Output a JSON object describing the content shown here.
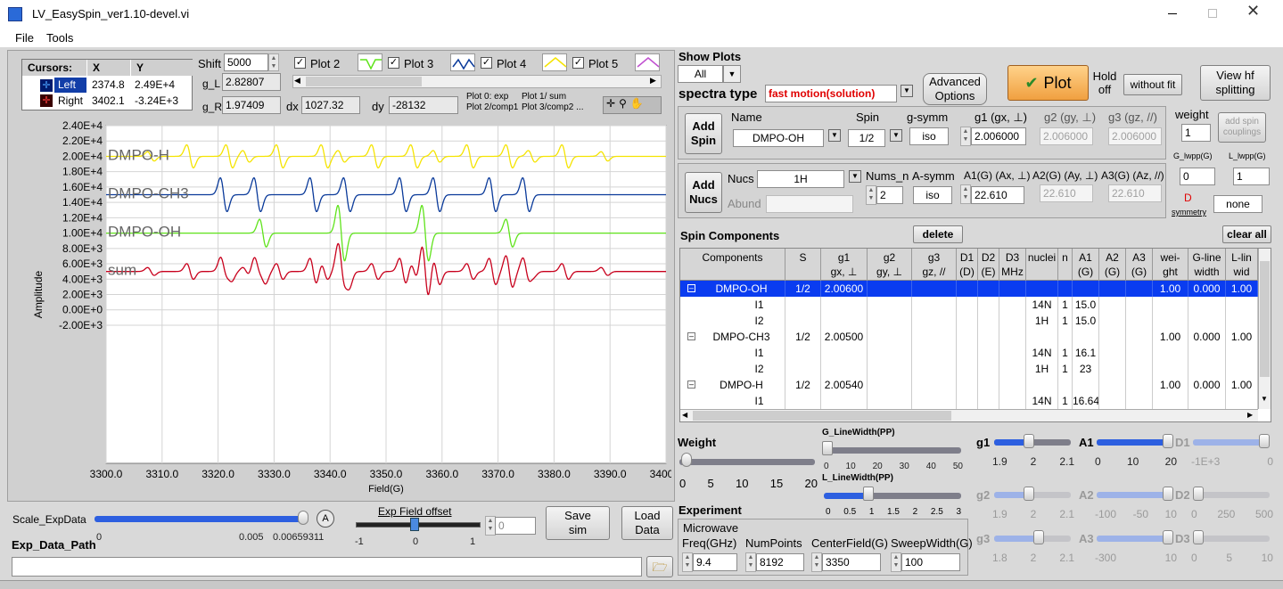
{
  "window": {
    "title": "LV_EasySpin_ver1.10-devel.vi"
  },
  "menu": [
    "File",
    "Tools"
  ],
  "cursors": {
    "header": [
      "Cursors:",
      "X",
      "Y"
    ],
    "rows": [
      {
        "name": "Left",
        "x": "2374.8",
        "y": "2.49E+4"
      },
      {
        "name": "Right",
        "x": "3402.1",
        "y": "-3.24E+3"
      }
    ]
  },
  "shift": {
    "label": "Shift",
    "value": "5000"
  },
  "gL": {
    "label": "g_L",
    "value": "2.82807"
  },
  "gR": {
    "label": "g_R",
    "value": "1.97409"
  },
  "dx": {
    "label": "dx",
    "value": "1027.32"
  },
  "dy": {
    "label": "dy",
    "value": "-28132"
  },
  "plots": [
    "Plot 2",
    "Plot 3",
    "Plot 4",
    "Plot 5"
  ],
  "plot_legend": [
    "Plot 0: exp",
    "Plot 1/ sum",
    "Plot 2/comp1",
    "Plot 3/comp2 ..."
  ],
  "chart_data": {
    "type": "line",
    "xlabel": "Field(G)",
    "ylabel": "Amplitude",
    "xlim": [
      3300,
      3400
    ],
    "ylim": [
      -20000,
      24000
    ],
    "x_ticks": [
      "3300.0",
      "3310.0",
      "3320.0",
      "3330.0",
      "3340.0",
      "3350.0",
      "3360.0",
      "3370.0",
      "3380.0",
      "3390.0",
      "3400.0"
    ],
    "y_ticks": [
      "-2.00E+3",
      "0.00E+0",
      "2.00E+3",
      "4.00E+3",
      "6.00E+3",
      "8.00E+3",
      "1.00E+4",
      "1.20E+4",
      "1.40E+4",
      "1.60E+4",
      "1.80E+4",
      "2.00E+4",
      "2.20E+4",
      "2.40E+4"
    ],
    "series": [
      {
        "name": "DMPO-H",
        "color": "#f5e400",
        "baseline": 20000,
        "amp": 1500,
        "lines": [
          {
            "x": 3308,
            "w": 0.4
          },
          {
            "x": 3315,
            "w": 1
          },
          {
            "x": 3322,
            "w": 1
          },
          {
            "x": 3325,
            "w": 0.5
          },
          {
            "x": 3331,
            "w": 1
          },
          {
            "x": 3339,
            "w": 1
          },
          {
            "x": 3342,
            "w": 0.5
          },
          {
            "x": 3348,
            "w": 1
          },
          {
            "x": 3355,
            "w": 1
          },
          {
            "x": 3359,
            "w": 0.5
          },
          {
            "x": 3365,
            "w": 1
          },
          {
            "x": 3372,
            "w": 1
          },
          {
            "x": 3376,
            "w": 0.5
          },
          {
            "x": 3382,
            "w": 1
          },
          {
            "x": 3389,
            "w": 0.4
          }
        ]
      },
      {
        "name": "DMPO-CH3",
        "color": "#0a3a9a",
        "baseline": 15000,
        "amp": 2200,
        "lines": [
          {
            "x": 3321,
            "w": 1
          },
          {
            "x": 3327,
            "w": 1
          },
          {
            "x": 3337,
            "w": 1
          },
          {
            "x": 3343,
            "w": 1
          },
          {
            "x": 3353,
            "w": 1
          },
          {
            "x": 3359,
            "w": 1
          },
          {
            "x": 3369,
            "w": 1
          },
          {
            "x": 3375,
            "w": 1
          }
        ]
      },
      {
        "name": "DMPO-OH",
        "color": "#5fe31b",
        "baseline": 10000,
        "amp": 3600,
        "lines": [
          {
            "x": 3328,
            "w": 0.5
          },
          {
            "x": 3342,
            "w": 1
          },
          {
            "x": 3357,
            "w": 1
          },
          {
            "x": 3372,
            "w": 0.5
          }
        ]
      },
      {
        "name": "sum",
        "color": "#c8001c",
        "baseline": 5000,
        "amp": 1700,
        "lines": [
          {
            "x": 3308,
            "w": 0.3
          },
          {
            "x": 3315,
            "w": 0.6
          },
          {
            "x": 3321,
            "w": 1
          },
          {
            "x": 3322,
            "w": 0.6
          },
          {
            "x": 3325,
            "w": 0.3
          },
          {
            "x": 3327,
            "w": 1
          },
          {
            "x": 3328,
            "w": 0.8
          },
          {
            "x": 3331,
            "w": 0.6
          },
          {
            "x": 3337,
            "w": 1
          },
          {
            "x": 3339,
            "w": 0.6
          },
          {
            "x": 3342,
            "w": 2
          },
          {
            "x": 3343,
            "w": 1
          },
          {
            "x": 3348,
            "w": 0.6
          },
          {
            "x": 3353,
            "w": 1
          },
          {
            "x": 3355,
            "w": 0.6
          },
          {
            "x": 3357,
            "w": 2
          },
          {
            "x": 3359,
            "w": 1
          },
          {
            "x": 3365,
            "w": 0.6
          },
          {
            "x": 3369,
            "w": 1
          },
          {
            "x": 3372,
            "w": 1.2
          },
          {
            "x": 3375,
            "w": 1
          },
          {
            "x": 3376,
            "w": 0.3
          },
          {
            "x": 3382,
            "w": 0.6
          },
          {
            "x": 3389,
            "w": 0.3
          }
        ]
      }
    ]
  },
  "show_plots": {
    "label": "Show Plots",
    "value": "All"
  },
  "spectra_type": {
    "label": "spectra type",
    "value": "fast motion(solution)"
  },
  "buttons": {
    "advanced": "Advanced Options",
    "plot": "Plot",
    "hold": "Hold off",
    "without_fit": "without fit",
    "view_hf": "View hf splitting",
    "add_spin": "Add Spin",
    "add_nucs": "Add Nucs",
    "delete": "delete",
    "clear_all": "clear all",
    "save_sim": "Save sim",
    "load_data": "Load Data",
    "add_spin_couplings": "add spin couplings"
  },
  "spin": {
    "name_label": "Name",
    "name": "DMPO-OH",
    "spin_label": "Spin",
    "spin": "1/2",
    "gsymm_label": "g-symm",
    "gsymm": "iso",
    "g1_label": "g1 (gx, ⊥)",
    "g1": "2.006000",
    "g2_label": "g2 (gy, ⊥)",
    "g2": "2.006000",
    "g3_label": "g3 (gz, //)",
    "g3": "2.006000",
    "weight_label": "weight",
    "weight": "1"
  },
  "nucs": {
    "nucs_label": "Nucs",
    "nucs": "1H",
    "abund_label": "Abund",
    "numsn_label": "Nums_n",
    "numsn": "2",
    "asymm_label": "A-symm",
    "asymm": "iso",
    "a1_label": "A1(G) (Ax, ⊥)",
    "a1": "22.610",
    "a2_label": "A2(G) (Ay, ⊥)",
    "a2": "22.610",
    "a3_label": "A3(G) (Az, //)",
    "a3": "22.610"
  },
  "lw": {
    "g_label": "G_lwpp(G)",
    "g": "0",
    "l_label": "L_lwpp(G)",
    "l": "1",
    "d_label": "D",
    "symm_label": "symmetry",
    "symm": "none"
  },
  "components": {
    "title": "Spin Components",
    "headers": [
      [
        "Components",
        ""
      ],
      [
        "S",
        ""
      ],
      [
        "g1",
        "gx, ⊥"
      ],
      [
        "g2",
        "gy, ⊥"
      ],
      [
        "g3",
        "gz, //"
      ],
      [
        "D1",
        "(D)"
      ],
      [
        "D2",
        "(E)"
      ],
      [
        "D3",
        "MHz"
      ],
      [
        "nuclei",
        ""
      ],
      [
        "n",
        ""
      ],
      [
        "A1",
        "(G)"
      ],
      [
        "A2",
        "(G)"
      ],
      [
        "A3",
        "(G)"
      ],
      [
        "wei-",
        "ght"
      ],
      [
        "G-line",
        "width"
      ],
      [
        "L-lin",
        "wid"
      ]
    ],
    "rows": [
      [
        "DMPO-OH",
        "1/2",
        "2.00600",
        "",
        "",
        "",
        "",
        "",
        "",
        "",
        "",
        "",
        "",
        "1.00",
        "0.000",
        "1.00"
      ],
      [
        "I1",
        "",
        "",
        "",
        "",
        "",
        "",
        "",
        "14N",
        "1",
        "15.0",
        "",
        "",
        "",
        "",
        ""
      ],
      [
        "I2",
        "",
        "",
        "",
        "",
        "",
        "",
        "",
        "1H",
        "1",
        "15.0",
        "",
        "",
        "",
        "",
        ""
      ],
      [
        "DMPO-CH3",
        "1/2",
        "2.00500",
        "",
        "",
        "",
        "",
        "",
        "",
        "",
        "",
        "",
        "",
        "1.00",
        "0.000",
        "1.00"
      ],
      [
        "I1",
        "",
        "",
        "",
        "",
        "",
        "",
        "",
        "14N",
        "1",
        "16.1",
        "",
        "",
        "",
        "",
        ""
      ],
      [
        "I2",
        "",
        "",
        "",
        "",
        "",
        "",
        "",
        "1H",
        "1",
        "23",
        "",
        "",
        "",
        "",
        ""
      ],
      [
        "DMPO-H",
        "1/2",
        "2.00540",
        "",
        "",
        "",
        "",
        "",
        "",
        "",
        "",
        "",
        "",
        "1.00",
        "0.000",
        "1.00"
      ],
      [
        "I1",
        "",
        "",
        "",
        "",
        "",
        "",
        "",
        "14N",
        "1",
        "16.64",
        "",
        "",
        "",
        "",
        ""
      ]
    ]
  },
  "weight_slider": {
    "label": "Weight",
    "ticks": [
      "0",
      "5",
      "10",
      "15",
      "20"
    ],
    "value": 1
  },
  "glw_slider": {
    "label": "G_LineWidth(PP)",
    "ticks": [
      "0",
      "10",
      "20",
      "30",
      "40",
      "50"
    ],
    "value": 0
  },
  "llw_slider": {
    "label": "L_LineWidth(PP)",
    "ticks": [
      "0",
      "0.5",
      "1",
      "1.5",
      "2",
      "2.5",
      "3"
    ],
    "value": 1
  },
  "experiment": {
    "label": "Experiment",
    "microwave_label": "Microwave",
    "freq_label": "Freq(GHz)",
    "freq": "9.4",
    "np_label": "NumPoints",
    "np": "8192",
    "cf_label": "CenterField(G)",
    "cf": "3350",
    "sw_label": "SweepWidth(G)",
    "sw": "100"
  },
  "param_sliders": [
    {
      "label": "g1",
      "ticks": [
        "1.9",
        "2",
        "2.1"
      ],
      "frac": 0.45,
      "dim": false
    },
    {
      "label": "A1",
      "ticks": [
        "0",
        "10",
        "20"
      ],
      "frac": 1.0,
      "dim": false
    },
    {
      "label": "D1",
      "ticks": [
        "-1E+3",
        "0"
      ],
      "frac": 1.0,
      "dim": true
    },
    {
      "label": "g2",
      "ticks": [
        "1.9",
        "2",
        "2.1"
      ],
      "frac": 0.45,
      "dim": true
    },
    {
      "label": "A2",
      "ticks": [
        "-100",
        "-50",
        "10"
      ],
      "frac": 1.0,
      "dim": true
    },
    {
      "label": "D2",
      "ticks": [
        "0",
        "250",
        "500"
      ],
      "frac": 0,
      "dim": true
    },
    {
      "label": "g3",
      "ticks": [
        "1.8",
        "2",
        "2.1"
      ],
      "frac": 0.6,
      "dim": true
    },
    {
      "label": "A3",
      "ticks": [
        "-300",
        "10"
      ],
      "frac": 1.0,
      "dim": true
    },
    {
      "label": "D3",
      "ticks": [
        "0",
        "5",
        "10"
      ],
      "frac": 0,
      "dim": true
    }
  ],
  "scale": {
    "label": "Scale_ExpData",
    "ticks": [
      "0",
      "0.005",
      "0.00659311"
    ],
    "button": "A"
  },
  "exp_offset": {
    "label": "Exp Field offset",
    "ticks": [
      "-1",
      "0",
      "1"
    ],
    "value": "0"
  },
  "path": {
    "label": "Exp_Data_Path",
    "value": ""
  }
}
